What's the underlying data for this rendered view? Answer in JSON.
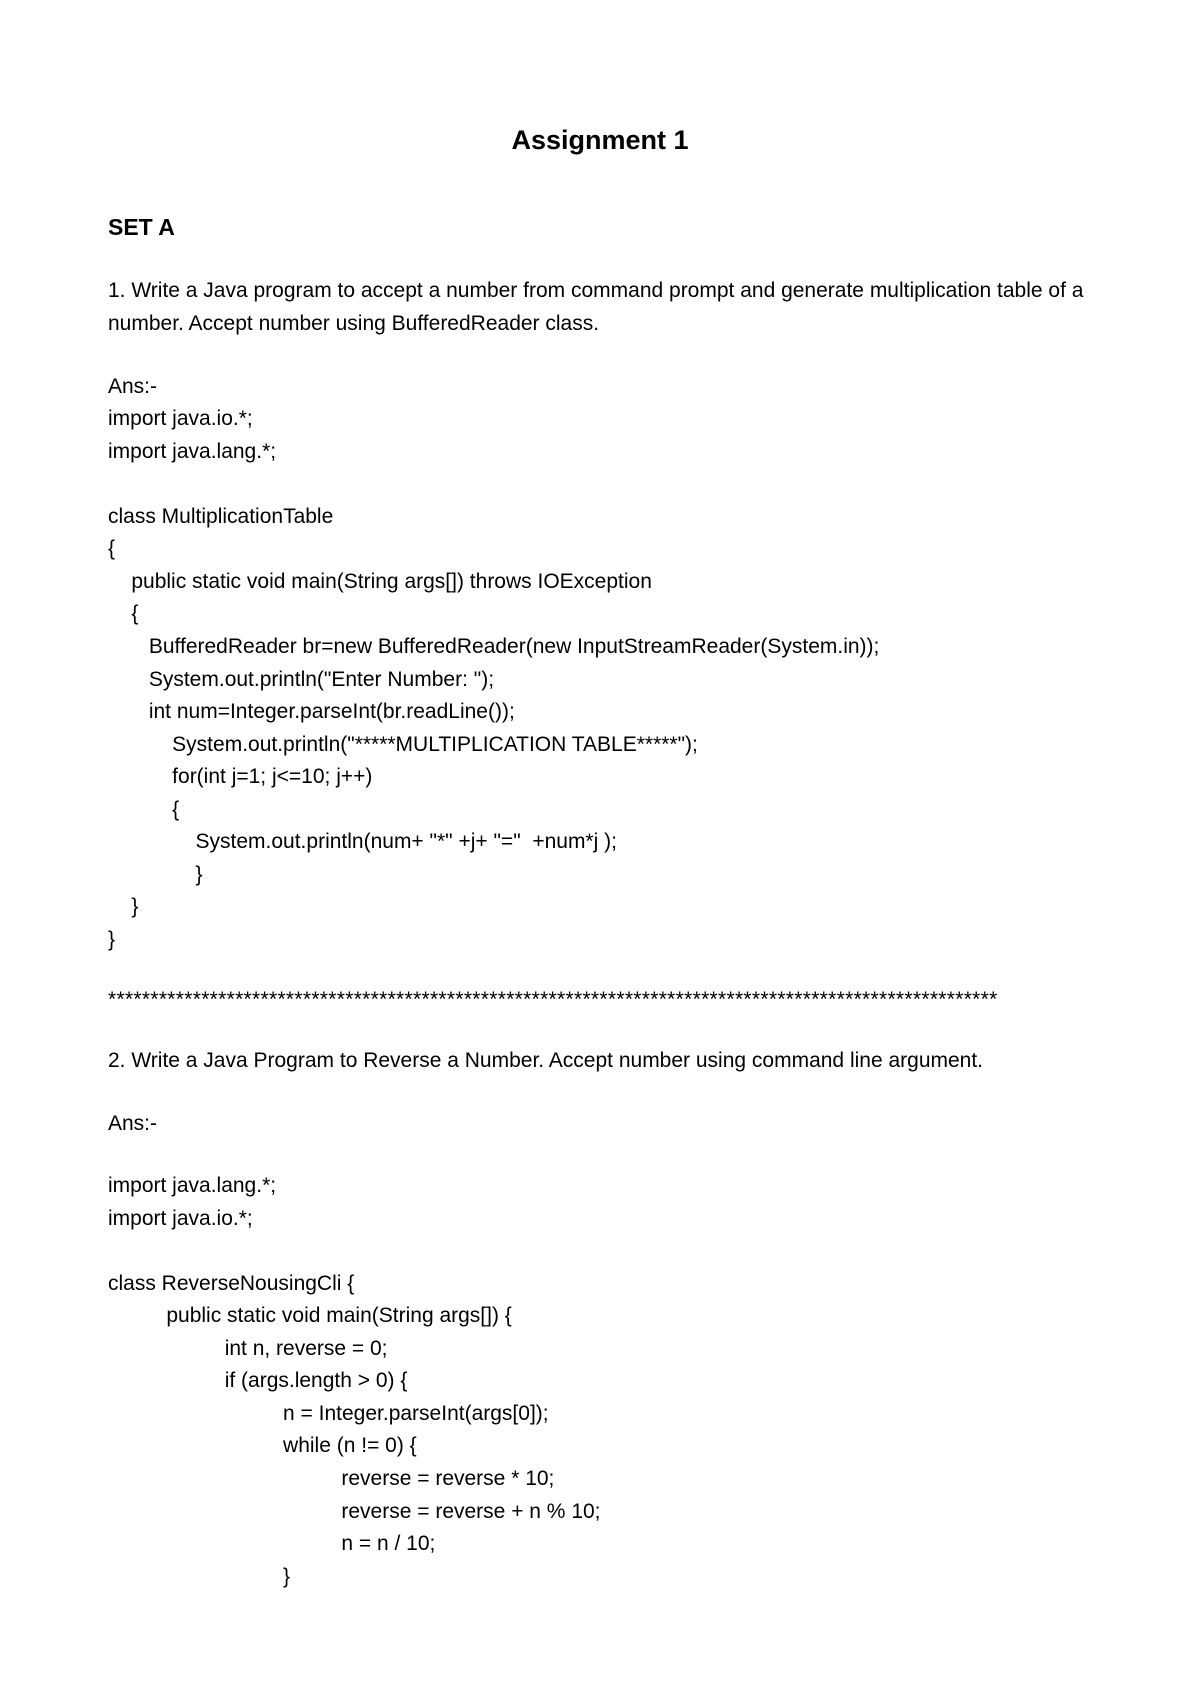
{
  "title": "Assignment 1",
  "set_heading": "SET A",
  "q1": {
    "text": "1. Write a Java program to accept a number from command prompt and generate multiplication table of a number. Accept number using BufferedReader class.",
    "ans_label": "Ans:-",
    "code": "import java.io.*;\nimport java.lang.*;\n\nclass MultiplicationTable\n{\n    public static void main(String args[]) throws IOException\n    {\n       BufferedReader br=new BufferedReader(new InputStreamReader(System.in));\n       System.out.println(\"Enter Number: \");\n       int num=Integer.parseInt(br.readLine());\n           System.out.println(\"*****MULTIPLICATION TABLE*****\");\n           for(int j=1; j<=10; j++)\n           {\n               System.out.println(num+ \"*\" +j+ \"=\"  +num*j );\n               }\n    }\n}"
  },
  "separator": "*********************************************************************************************************",
  "q2": {
    "text": "2. Write a Java Program to Reverse a Number. Accept number using command line argument.",
    "ans_label": "Ans:-",
    "code": "import java.lang.*;\nimport java.io.*;\n\nclass ReverseNousingCli {\n          public static void main(String args[]) {\n                    int n, reverse = 0;\n                    if (args.length > 0) {\n                              n = Integer.parseInt(args[0]);\n                              while (n != 0) {\n                                        reverse = reverse * 10;\n                                        reverse = reverse + n % 10;\n                                        n = n / 10;\n                              }"
  }
}
